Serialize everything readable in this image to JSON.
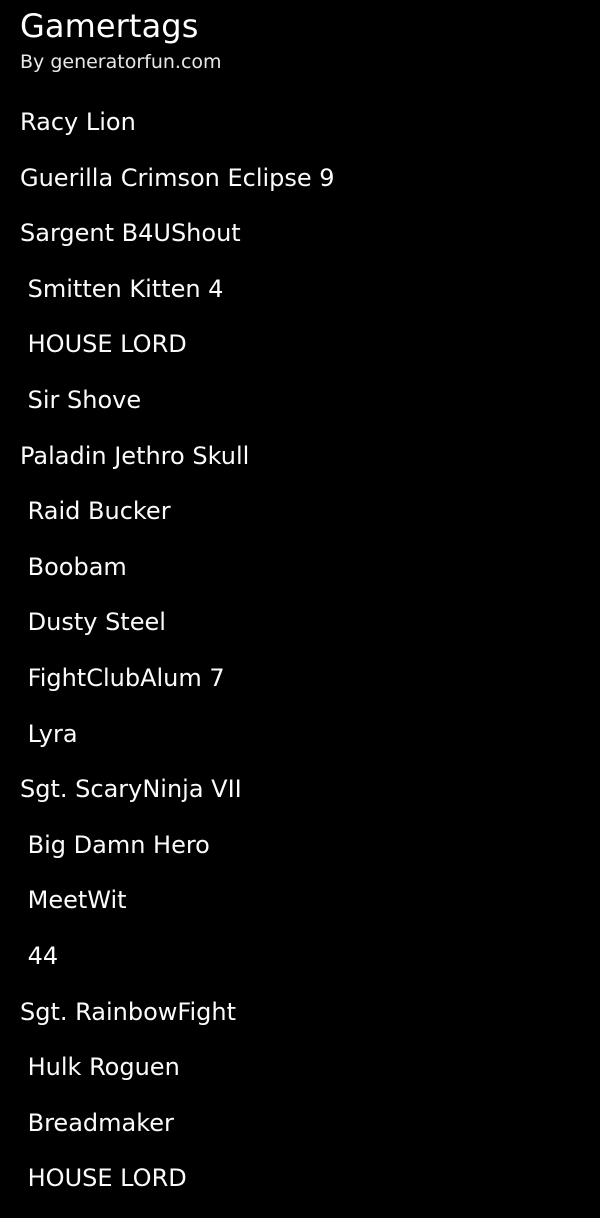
{
  "header": {
    "title": "Gamertags",
    "byline": "By generatorfun.com"
  },
  "colors": {
    "background": "#000000",
    "title_text": "#ffffff",
    "byline_text": "#e8e8e8",
    "item_text": "#fbfbfb"
  },
  "list": {
    "items": [
      {
        "label": "Racy Lion"
      },
      {
        "label": "Guerilla Crimson Eclipse 9"
      },
      {
        "label": "Sargent B4UShout"
      },
      {
        "label": " Smitten Kitten 4"
      },
      {
        "label": " HOUSE LORD"
      },
      {
        "label": " Sir Shove"
      },
      {
        "label": "Paladin Jethro Skull"
      },
      {
        "label": " Raid Bucker"
      },
      {
        "label": " Boobam"
      },
      {
        "label": " Dusty Steel"
      },
      {
        "label": " FightClubAlum 7"
      },
      {
        "label": " Lyra"
      },
      {
        "label": "Sgt. ScaryNinja VII"
      },
      {
        "label": " Big Damn Hero"
      },
      {
        "label": " MeetWit"
      },
      {
        "label": " 44"
      },
      {
        "label": "Sgt. RainbowFight"
      },
      {
        "label": " Hulk Roguen"
      },
      {
        "label": " Breadmaker"
      },
      {
        "label": " HOUSE LORD"
      }
    ]
  }
}
